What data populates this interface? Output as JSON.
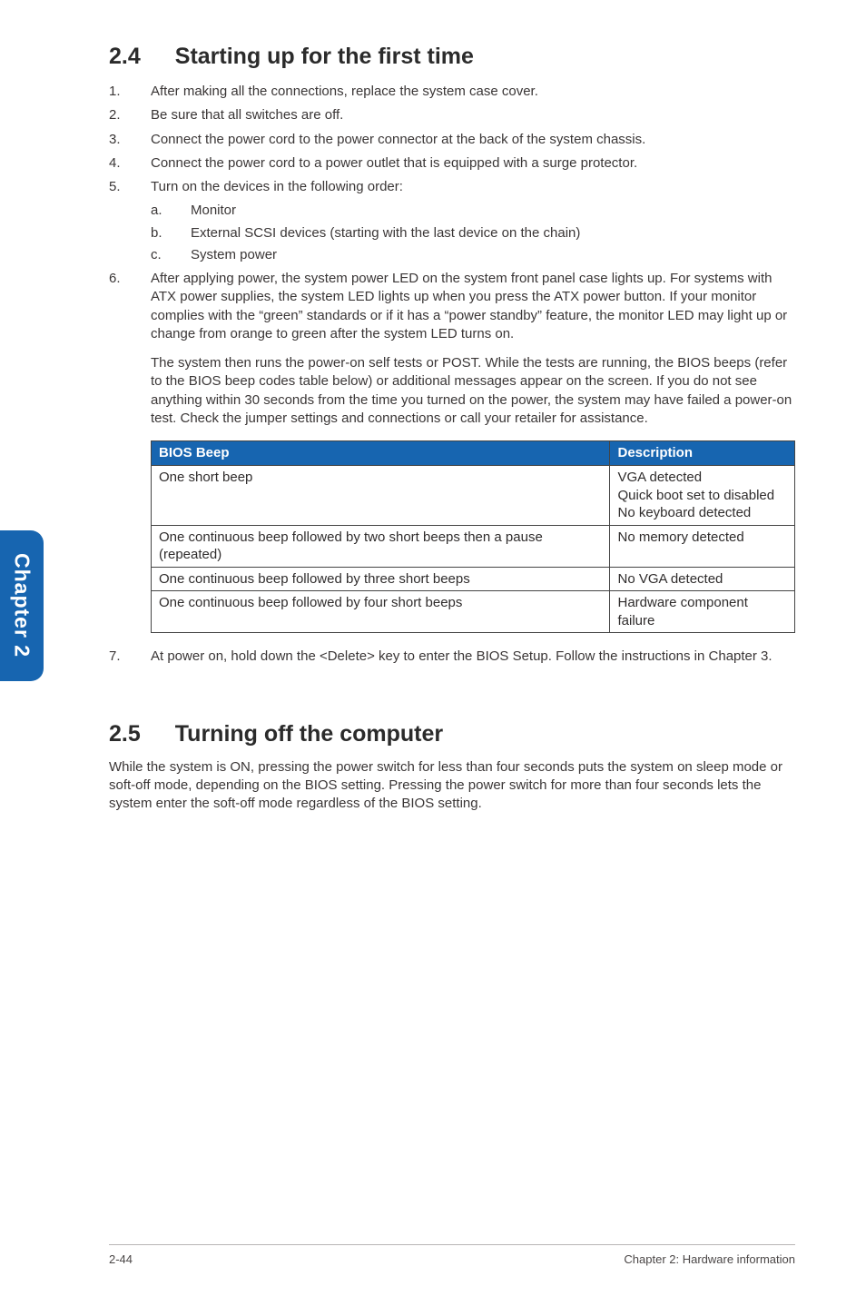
{
  "sideTab": "Chapter 2",
  "section24": {
    "num": "2.4",
    "title": "Starting up for the first time"
  },
  "list24": {
    "i1": "After making all the connections, replace the system case cover.",
    "i2": "Be sure that all switches are off.",
    "i3": "Connect the power cord to the power connector at the back of the system chassis.",
    "i4": "Connect the power cord to a power outlet that is equipped with a surge protector.",
    "i5": "Turn on the devices in the following order:",
    "i5a_l": "a.",
    "i5a": "Monitor",
    "i5b_l": "b.",
    "i5b": "External SCSI devices (starting with the last device on the chain)",
    "i5c_l": "c.",
    "i5c": "System power",
    "i6a": "After applying power, the system power LED on the system front panel case lights up. For systems with ATX power supplies, the system LED lights up when you press the ATX power button. If your monitor complies with the “green” standards or if it has a “power standby” feature, the monitor LED may light up or change from orange to green after the system LED turns on.",
    "i6b": "The system then runs the power-on self tests or POST. While the tests are running, the BIOS beeps (refer to the BIOS beep codes table below) or additional messages appear on the screen. If you do not see anything within 30 seconds from the time you turned on the power, the system may have failed a power-on test. Check the jumper settings and connections or call your retailer for assistance.",
    "i7": "At power on, hold down the <Delete> key to enter the BIOS Setup. Follow the instructions in Chapter 3."
  },
  "table": {
    "h1": "BIOS Beep",
    "h2": "Description",
    "r1c1": "One short beep",
    "r1c2_l1": "VGA detected",
    "r1c2_l2": "Quick boot set to disabled",
    "r1c2_l3": "No keyboard detected",
    "r2c1": "One continuous beep followed by two short beeps then a pause (repeated)",
    "r2c2": "No memory detected",
    "r3c1": "One continuous beep followed by three short beeps",
    "r3c2": "No VGA detected",
    "r4c1": "One continuous beep followed by four short beeps",
    "r4c2": "Hardware component failure"
  },
  "section25": {
    "num": "2.5",
    "title": "Turning off the computer",
    "body": "While the system is ON, pressing the power switch for less than four seconds puts the system on sleep mode or soft-off mode, depending on the BIOS setting. Pressing the power switch for more than four seconds lets the system enter the soft-off mode regardless of the BIOS setting."
  },
  "footer": {
    "left": "2-44",
    "right": "Chapter 2: Hardware information"
  }
}
